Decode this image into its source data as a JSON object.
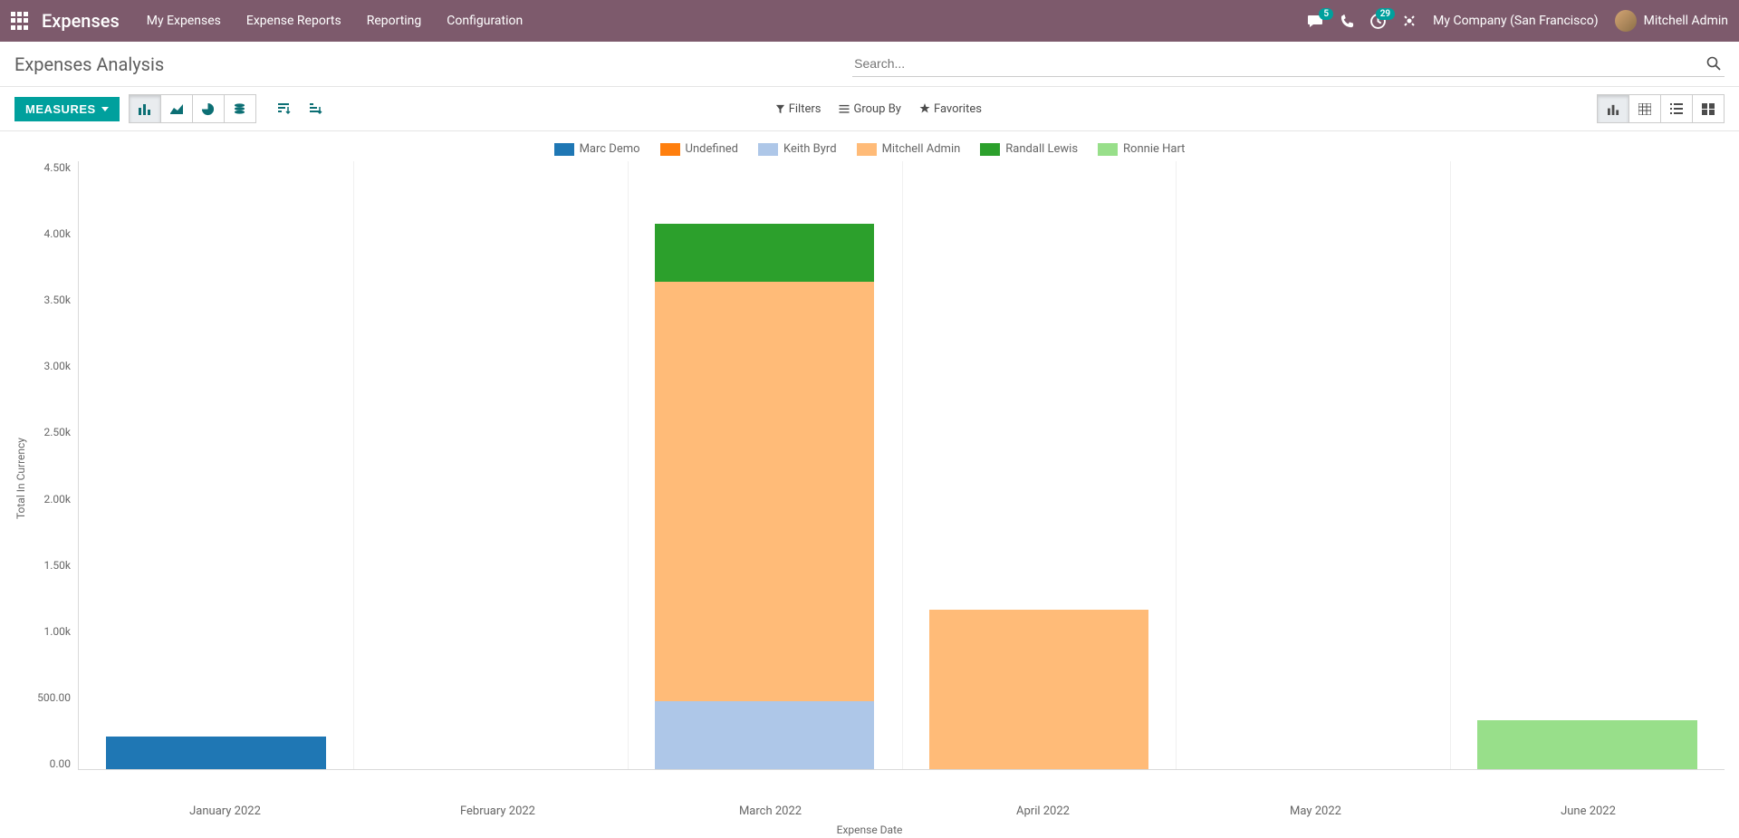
{
  "topnav": {
    "brand": "Expenses",
    "links": [
      "My Expenses",
      "Expense Reports",
      "Reporting",
      "Configuration"
    ],
    "message_badge": "5",
    "activity_badge": "29",
    "company": "My Company (San Francisco)",
    "user": "Mitchell Admin"
  },
  "page": {
    "title": "Expenses Analysis",
    "search_placeholder": "Search...",
    "measures_label": "MEASURES",
    "filters_label": "Filters",
    "groupby_label": "Group By",
    "favorites_label": "Favorites"
  },
  "chart_data": {
    "type": "bar",
    "stacked": true,
    "xlabel": "Expense Date",
    "ylabel": "Total In Currency",
    "ylim": [
      0,
      4500
    ],
    "y_ticks": [
      "4.50k",
      "4.00k",
      "3.50k",
      "3.00k",
      "2.50k",
      "2.00k",
      "1.50k",
      "1.00k",
      "500.00",
      "0.00"
    ],
    "categories": [
      "January 2022",
      "February 2022",
      "March 2022",
      "April 2022",
      "May 2022",
      "June 2022"
    ],
    "series": [
      {
        "name": "Marc Demo",
        "color": "#1f77b4",
        "values": [
          240,
          0,
          0,
          0,
          0,
          0
        ]
      },
      {
        "name": "Undefined",
        "color": "#ff7f0e",
        "values": [
          0,
          0,
          0,
          0,
          0,
          0
        ]
      },
      {
        "name": "Keith Byrd",
        "color": "#aec7e8",
        "values": [
          0,
          0,
          500,
          0,
          0,
          0
        ]
      },
      {
        "name": "Mitchell Admin",
        "color": "#ffbb78",
        "values": [
          0,
          0,
          3100,
          1180,
          0,
          0
        ]
      },
      {
        "name": "Randall Lewis",
        "color": "#2ca02c",
        "values": [
          0,
          0,
          430,
          0,
          0,
          0
        ]
      },
      {
        "name": "Ronnie Hart",
        "color": "#98df8a",
        "values": [
          0,
          0,
          0,
          0,
          0,
          360
        ]
      }
    ]
  }
}
